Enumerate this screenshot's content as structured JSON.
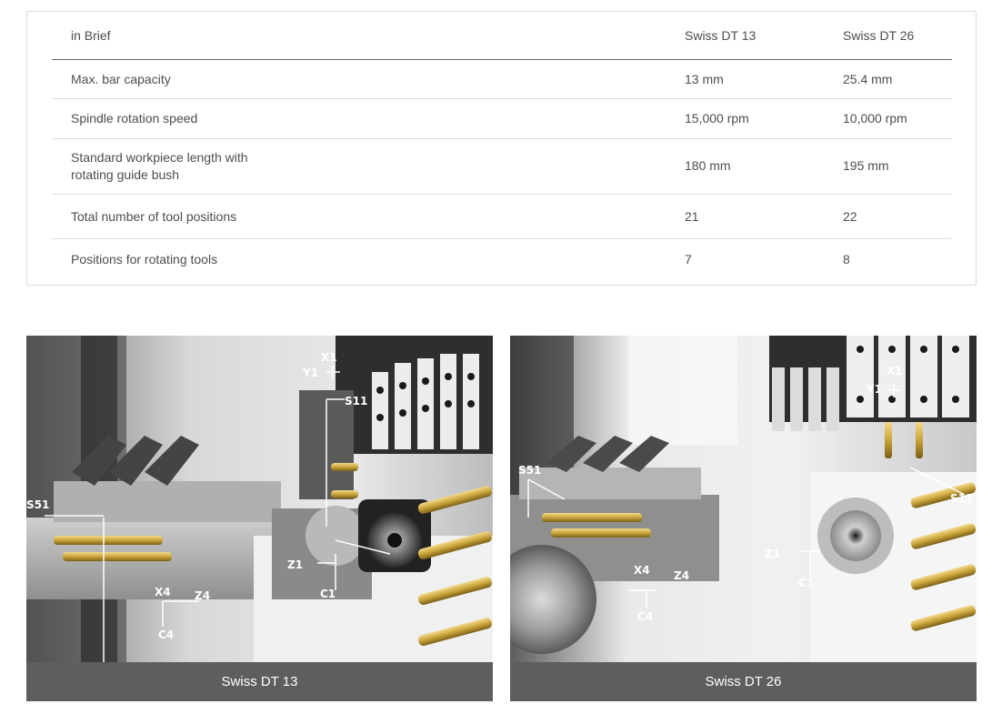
{
  "table": {
    "header": [
      "in Brief",
      "Swiss DT 13",
      "Swiss DT 26"
    ],
    "rows": [
      {
        "label": "Max. bar capacity",
        "dt13": "13 mm",
        "dt26": "25.4 mm"
      },
      {
        "label_line1": "Spindle rotation speed",
        "dt13": "15,000 rpm",
        "dt26": "10,000 rpm"
      },
      {
        "label_line1": "Standard workpiece length with",
        "label_line2": "rotating guide bush",
        "dt13": "180 mm",
        "dt26": "195 mm"
      },
      {
        "label": "Total number of tool positions",
        "dt13": "21",
        "dt26": "22"
      },
      {
        "label": "Positions for rotating tools",
        "dt13": "7",
        "dt26": "8"
      }
    ]
  },
  "figures": [
    {
      "caption": "Swiss DT 13",
      "axes": {
        "x1": "X1",
        "y1": "Y1",
        "s11": "S11",
        "s51": "S51",
        "z1": "Z1",
        "c1": "C1",
        "x4": "X4",
        "z4": "Z4",
        "c4": "C4"
      }
    },
    {
      "caption": "Swiss DT 26",
      "axes": {
        "x1": "X1",
        "y1": "Y1",
        "s11": "S11",
        "s51": "S51",
        "z1": "Z1",
        "c1": "C1",
        "x4": "X4",
        "z4": "Z4",
        "c4": "C4"
      }
    }
  ],
  "colors": {
    "caption_bg": "#5e5e5e",
    "tool_gold": "#c9a43a",
    "metal_dark": "#2e2e2e"
  }
}
